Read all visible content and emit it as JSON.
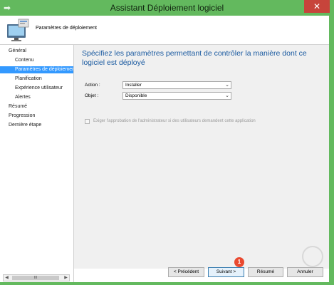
{
  "window": {
    "title": "Assistant Déploiement logiciel",
    "close_glyph": "✕"
  },
  "header": {
    "title": "Paramètres de déploiement",
    "icon": "computer-install-icon"
  },
  "sidebar": {
    "items": [
      {
        "label": "Général",
        "level": "top",
        "active": false
      },
      {
        "label": "Contenu",
        "level": "sub",
        "active": false
      },
      {
        "label": "Paramètres de déploiement",
        "level": "sub",
        "active": true
      },
      {
        "label": "Planification",
        "level": "sub",
        "active": false
      },
      {
        "label": "Expérience utilisateur",
        "level": "sub",
        "active": false
      },
      {
        "label": "Alertes",
        "level": "sub",
        "active": false
      },
      {
        "label": "Résumé",
        "level": "top",
        "active": false
      },
      {
        "label": "Progression",
        "level": "top",
        "active": false
      },
      {
        "label": "Dernière étape",
        "level": "top",
        "active": false
      }
    ],
    "scroll_thumb_glyph": "III"
  },
  "main": {
    "heading": "Spécifiez les paramètres permettant de contrôler la manière dont ce logiciel est déployé",
    "action_label": "Action :",
    "action_value": "Installer",
    "objet_label": "Objet :",
    "objet_value": "Disponible",
    "approval_label": "Exiger l'approbation de l'administrateur si des utilisateurs demandent cette application",
    "approval_checked": false,
    "approval_enabled": false
  },
  "buttons": {
    "previous": "< Précédent",
    "next": "Suivant >",
    "summary": "Résumé",
    "cancel": "Annuler"
  },
  "annotations": {
    "step_badge": "1",
    "watermark": "RDR"
  },
  "colors": {
    "frame": "#63b95e",
    "heading": "#1a5aa0",
    "selection": "#3399ff",
    "badge": "#e9492f"
  }
}
